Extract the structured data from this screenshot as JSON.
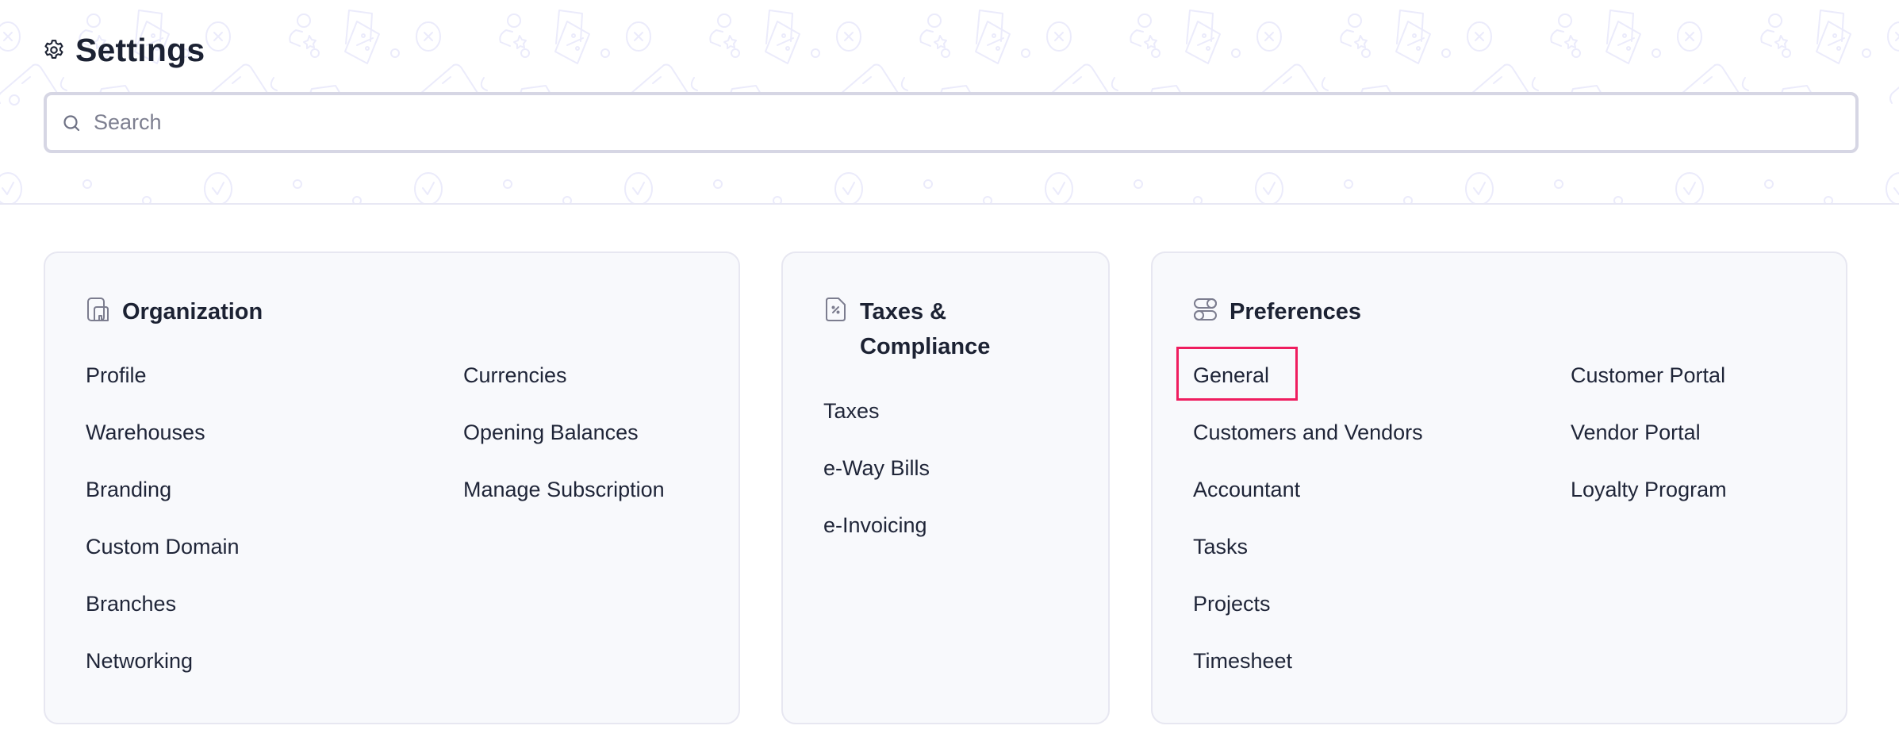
{
  "header": {
    "title": "Settings",
    "title_icon": "gear-icon"
  },
  "search": {
    "placeholder": "Search",
    "value": "",
    "icon": "search-icon"
  },
  "cards": [
    {
      "title": "Organization",
      "icon": "organization-building-icon",
      "left_items": [
        "Profile",
        "Warehouses",
        "Branding",
        "Custom Domain",
        "Branches",
        "Networking"
      ],
      "right_items": [
        "Currencies",
        "Opening Balances",
        "Manage Subscription"
      ]
    },
    {
      "title": "Taxes & Compliance",
      "icon": "tax-document-icon",
      "left_items": [
        "Taxes",
        "e-Way Bills",
        "e-Invoicing"
      ],
      "right_items": []
    },
    {
      "title": "Preferences",
      "icon": "toggles-icon",
      "left_items": [
        "General",
        "Customers and Vendors",
        "Accountant",
        "Tasks",
        "Projects",
        "Timesheet"
      ],
      "right_items": [
        "Customer Portal",
        "Vendor Portal",
        "Loyalty Program"
      ],
      "highlighted_item": "General"
    }
  ],
  "colors": {
    "highlight_border": "#ef1d5f",
    "text": "#1f2538",
    "card_bg": "#f8f9fc",
    "pattern": "#ebebfb"
  }
}
